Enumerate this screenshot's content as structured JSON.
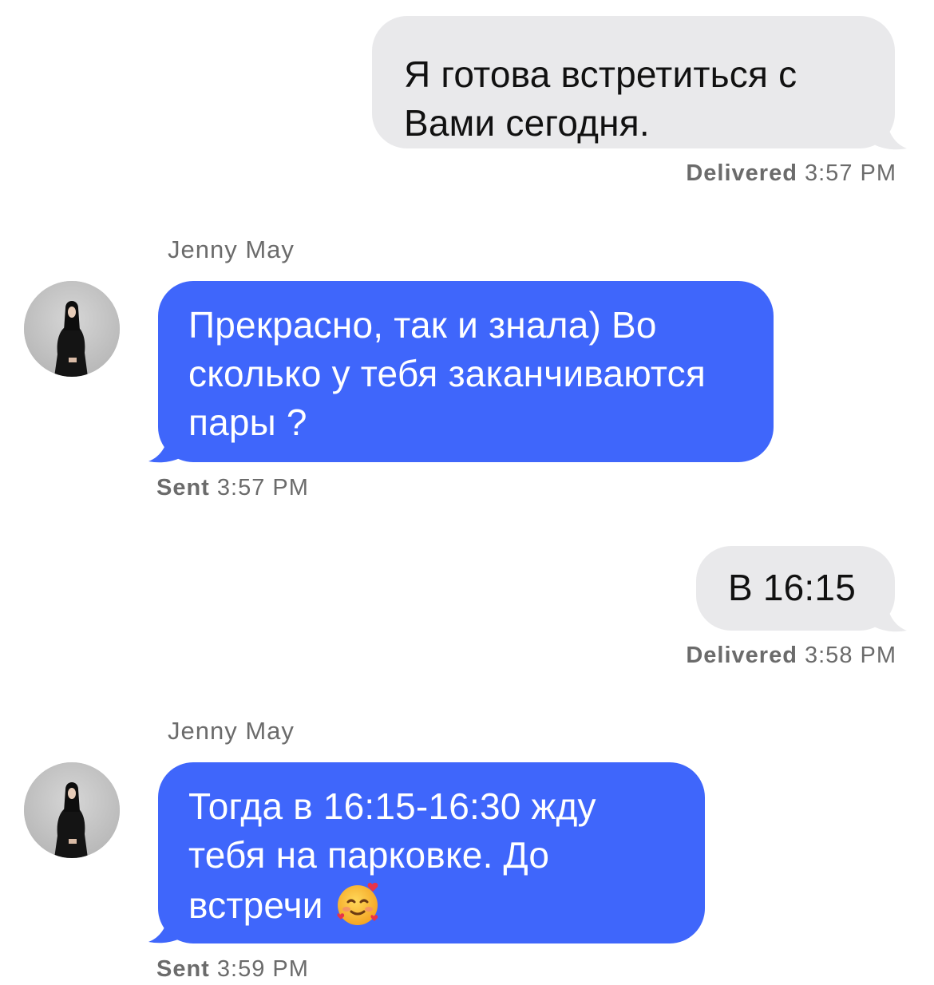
{
  "conversation": {
    "messages": [
      {
        "direction": "outgoing",
        "text": "Я готова встретиться с Вами сегодня.",
        "status": "Delivered",
        "time": "3:57 PM"
      },
      {
        "direction": "incoming",
        "sender": "Jenny May",
        "avatar_icon": "profile-photo",
        "text": "Прекрасно, так и знала) Во сколько у тебя заканчиваются пары ?",
        "status": "Sent",
        "time": "3:57 PM"
      },
      {
        "direction": "outgoing",
        "text": "В 16:15",
        "status": "Delivered",
        "time": "3:58 PM"
      },
      {
        "direction": "incoming",
        "sender": "Jenny May",
        "avatar_icon": "profile-photo",
        "text": "Тогда в 16:15-16:30 жду тебя на парковке. До встречи",
        "emoji": "smiling-face-with-hearts",
        "status": "Sent",
        "time": "3:59 PM"
      }
    ]
  },
  "colors": {
    "outgoing_bubble": "#e9e9eb",
    "incoming_bubble": "#3f66fb",
    "meta_text": "#6b6b6b"
  }
}
